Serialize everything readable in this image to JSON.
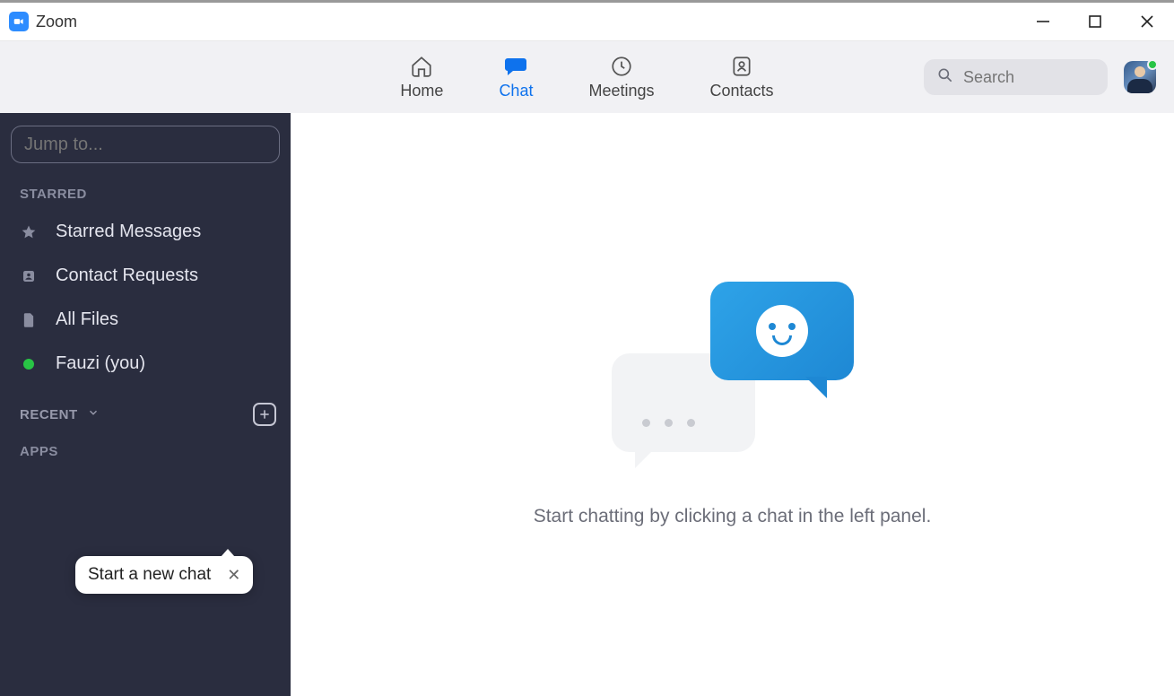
{
  "window": {
    "title": "Zoom"
  },
  "nav": {
    "home": "Home",
    "chat": "Chat",
    "meetings": "Meetings",
    "contacts": "Contacts",
    "active": "chat"
  },
  "search": {
    "placeholder": "Search"
  },
  "sidebar": {
    "jump_placeholder": "Jump to...",
    "sections": {
      "starred": "STARRED",
      "recent": "RECENT",
      "apps": "APPS"
    },
    "items": {
      "starred_messages": "Starred Messages",
      "contact_requests": "Contact Requests",
      "all_files": "All Files",
      "self": "Fauzi (you)"
    },
    "tooltip": "Start a new chat"
  },
  "main": {
    "empty_text": "Start chatting by clicking a chat in the left panel."
  },
  "colors": {
    "accent": "#0e72ed",
    "sidebar_bg": "#2a2d3f",
    "presence_online": "#28c445"
  }
}
